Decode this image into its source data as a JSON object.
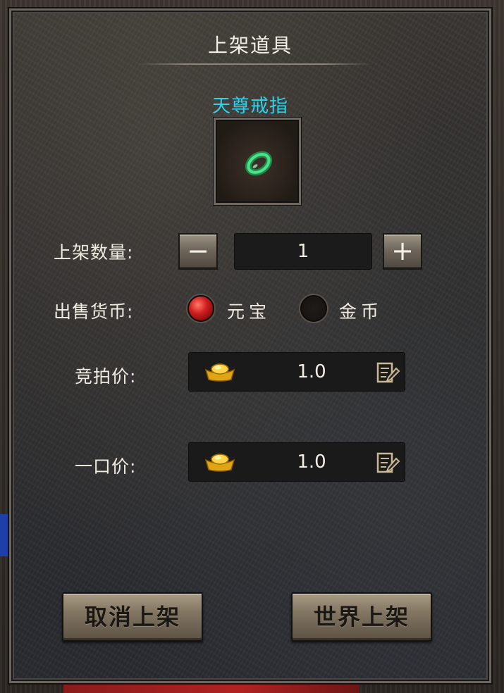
{
  "dialog": {
    "title": "上架道具"
  },
  "item": {
    "name": "天尊戒指",
    "name_color": "#2ad4f0",
    "icon": "green-ring-icon"
  },
  "quantity": {
    "label": "上架数量:",
    "value": "1",
    "minus": "−",
    "plus": "+"
  },
  "currency": {
    "label": "出售货币:",
    "options": [
      {
        "label": "元宝",
        "selected": true
      },
      {
        "label": "金币",
        "selected": false
      }
    ]
  },
  "prices": {
    "auction": {
      "label": "竞拍价:",
      "value": "1.0",
      "icon": "gold-ingot-icon"
    },
    "buyout": {
      "label": "一口价:",
      "value": "1.0",
      "icon": "gold-ingot-icon"
    }
  },
  "buttons": {
    "cancel": "取消上架",
    "confirm": "世界上架"
  },
  "colors": {
    "selected_radio": "#d01f1f",
    "accent_text": "#2ad4f0"
  }
}
